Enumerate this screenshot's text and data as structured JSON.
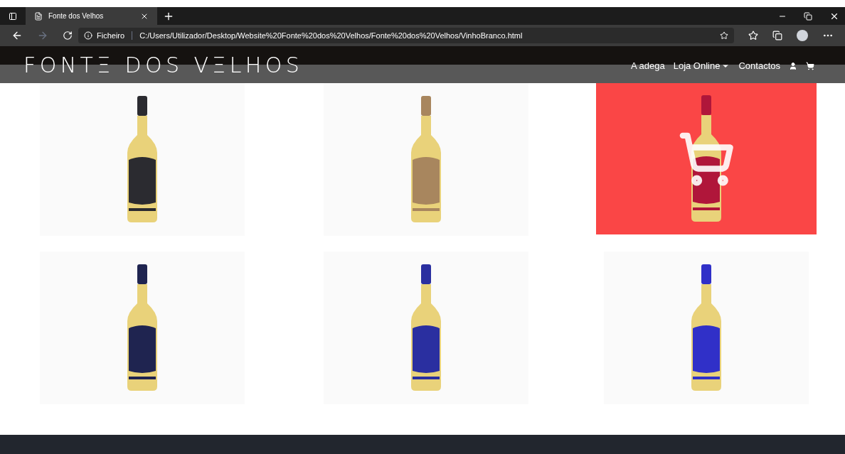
{
  "browser": {
    "tab_title": "Fonte dos Velhos",
    "address_prefix": "Ficheiro",
    "address": "C:/Users/Utilizador/Desktop/Website%20Fonte%20dos%20Velhos/Fonte%20dos%20Velhos/VinhoBranco.html"
  },
  "site": {
    "logo": "FONTΞ DOS VΞLHOS",
    "nav": [
      {
        "label": "A adega",
        "dropdown": false
      },
      {
        "label": "Loja Online",
        "dropdown": true
      },
      {
        "label": "Contactos",
        "dropdown": false
      }
    ]
  },
  "products": [
    {
      "color": "#2b2b30",
      "hovered": false
    },
    {
      "color": "#a8865e",
      "hovered": false
    },
    {
      "color": "#b0163a",
      "hovered": true
    },
    {
      "color": "#1f2450",
      "hovered": false
    },
    {
      "color": "#2a2fa0",
      "hovered": false
    },
    {
      "color": "#3030c8",
      "hovered": false
    }
  ]
}
